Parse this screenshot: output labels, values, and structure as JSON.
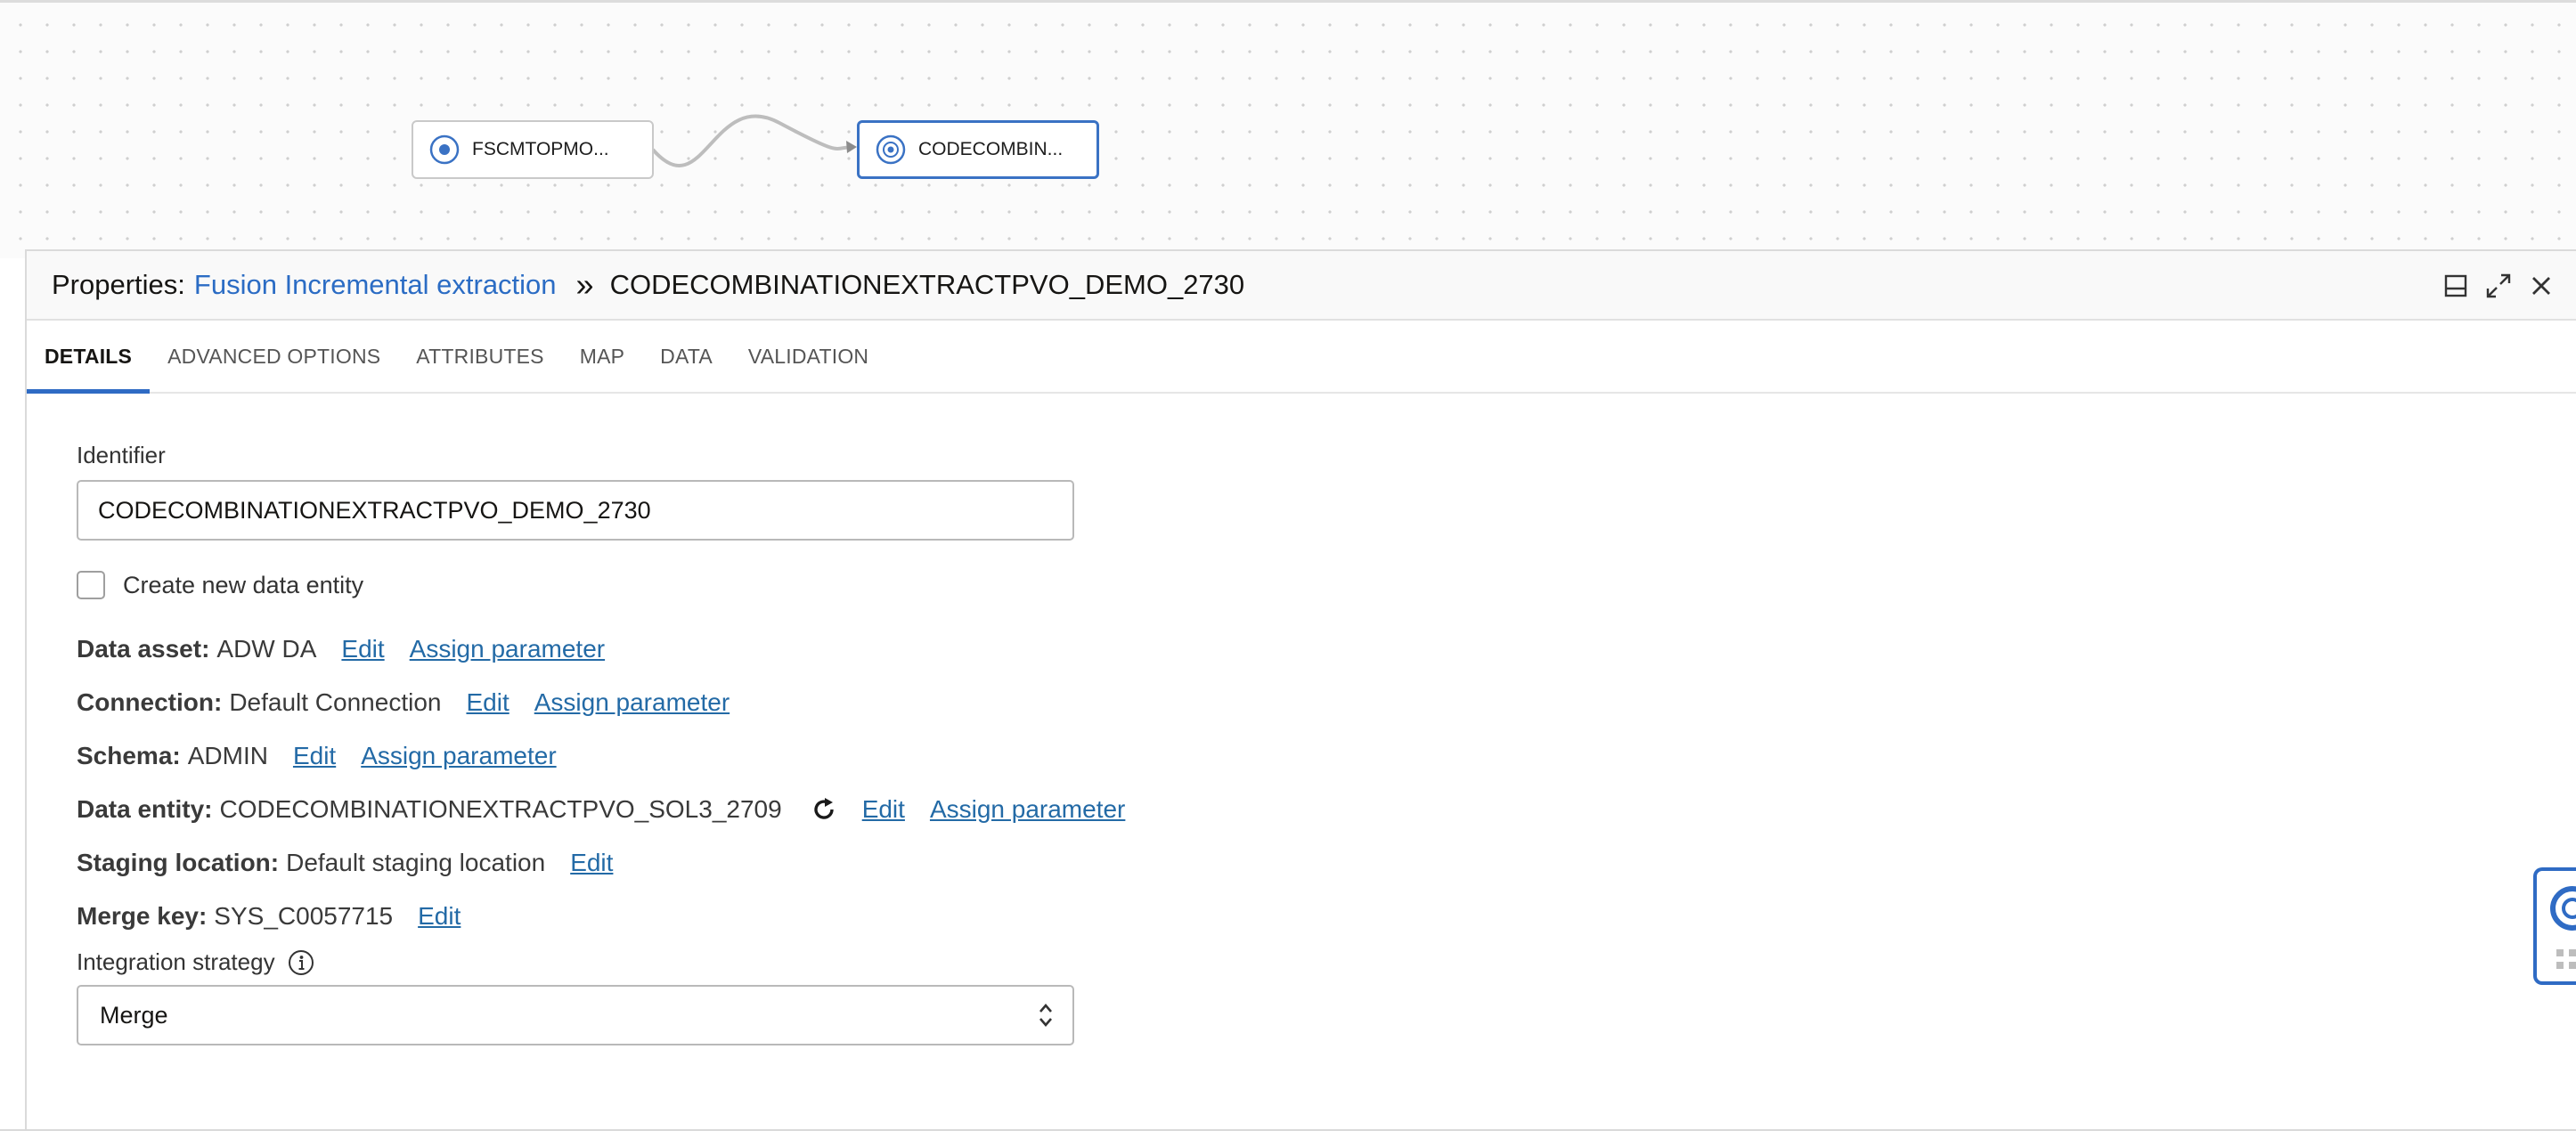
{
  "canvas": {
    "nodes": [
      {
        "label": "FSCMTOPMO..."
      },
      {
        "label": "CODECOMBIN..."
      }
    ]
  },
  "panel": {
    "prefix": "Properties:",
    "flow_link": "Fusion Incremental extraction",
    "separator": "»",
    "title": "CODECOMBINATIONEXTRACTPVO_DEMO_2730"
  },
  "tabs": [
    {
      "label": "DETAILS",
      "active": true
    },
    {
      "label": "ADVANCED OPTIONS"
    },
    {
      "label": "ATTRIBUTES"
    },
    {
      "label": "MAP"
    },
    {
      "label": "DATA"
    },
    {
      "label": "VALIDATION"
    }
  ],
  "details": {
    "identifier_label": "Identifier",
    "identifier_value": "CODECOMBINATIONEXTRACTPVO_DEMO_2730",
    "create_entity_label": "Create new data entity",
    "data_asset": {
      "key": "Data asset:",
      "value": "ADW DA",
      "edit": "Edit",
      "assign": "Assign parameter"
    },
    "connection": {
      "key": "Connection:",
      "value": "Default Connection",
      "edit": "Edit",
      "assign": "Assign parameter"
    },
    "schema": {
      "key": "Schema:",
      "value": "ADMIN",
      "edit": "Edit",
      "assign": "Assign parameter"
    },
    "data_entity": {
      "key": "Data entity:",
      "value": "CODECOMBINATIONEXTRACTPVO_SOL3_2709",
      "edit": "Edit",
      "assign": "Assign parameter"
    },
    "staging": {
      "key": "Staging location:",
      "value": "Default staging location",
      "edit": "Edit"
    },
    "merge_key": {
      "key": "Merge key:",
      "value": "SYS_C0057715",
      "edit": "Edit"
    },
    "strategy_label": "Integration strategy",
    "strategy_value": "Merge"
  },
  "colors": {
    "accent": "#2f6bc4",
    "link": "#236aa6"
  },
  "icons": [
    "source-node-icon",
    "target-node-icon",
    "restore-panel-icon",
    "expand-icon",
    "close-icon",
    "refresh-icon",
    "info-icon",
    "chevron-updown-icon",
    "help-lifebuoy-icon"
  ]
}
